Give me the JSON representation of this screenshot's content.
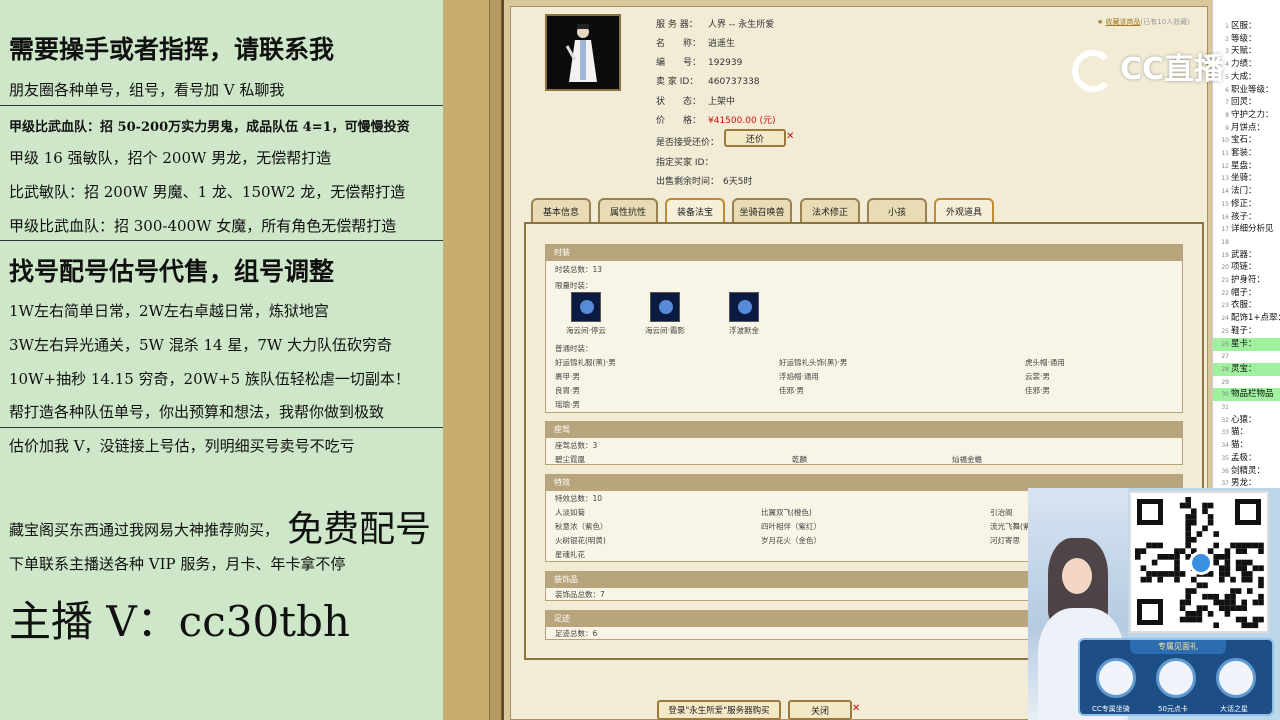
{
  "ad": {
    "line1": "需要操手或者指挥，请联系我",
    "line2": "朋友圈各种单号，组号，看号加 V 私聊我",
    "line3": "甲级比武血队：招 50-200万实力男鬼，成品队伍 4=1，可慢慢投资",
    "line4": "甲级 16 强敏队，招个 200W 男龙，无偿帮打造",
    "line5": "比武敏队：招 200W 男魔、1 龙、150W2 龙，无偿帮打造",
    "line6": "甲级比武血队：招 300-400W 女魔，所有角色无偿帮打造",
    "line7": "找号配号估号代售，组号调整",
    "line8": "1W左右简单日常，2W左右卓越日常，炼狱地宫",
    "line9": "3W左右异光通关，5W 混杀 14 星，7W 大力队伍砍穷奇",
    "line10": "10W+抽秒 14.15 穷奇，20W+5 族队伍轻松虐一切副本！",
    "line11": "帮打造各种队伍单号，你出预算和想法，我帮你做到极致",
    "line12": "估价加我 V，没链接上号估，列明细买号卖号不吃亏",
    "line13a": "藏宝阁买东西通过我网易大神推荐购买，",
    "line13b": "免费配号",
    "line14": "下单联系主播送各种 VIP 服务，月卡、年卡拿不停",
    "line15": "主播 V：cc30tbh"
  },
  "item": {
    "server_k": "服 务 器：",
    "server_v": "人界 -- 永生所爱",
    "name_k": "名　　称：",
    "name_v": "逍遥生",
    "num_k": "编　　号：",
    "num_v": "192939",
    "seller_k": "卖 家 ID：",
    "seller_v": "460737338",
    "status_k": "状　　态：",
    "status_v": "上架中",
    "price_k": "价　　格：",
    "price_v": "¥41500.00 (元)",
    "bargain_k": "是否接受还价：",
    "bargain_btn": "还价",
    "buyer_k": "指定买家 ID：",
    "remain_k": "出售剩余时间：",
    "remain_v": "6天5时",
    "fav": "收藏该商品",
    "fav_count": "(已有10人收藏)"
  },
  "tabs": [
    "基本信息",
    "属性抗性",
    "装备法宝",
    "坐骑召唤兽",
    "法术修正",
    "小孩",
    "外观道具"
  ],
  "sections": {
    "fashion": {
      "title": "时装",
      "total": "时装总数：13",
      "limited": "限量时装：",
      "icons": [
        "海云间·停云",
        "海云间·霜影",
        "浮波默金"
      ],
      "normal": "普通时装：",
      "items": [
        "好运锦礼服(黑)·男",
        "好运锦礼头饰(黑)·男",
        "虎头帽·通用",
        "裹甲·男",
        "浮焰帽·通用",
        "云裳·男",
        "良胄·男",
        "佳邪·男",
        "佳邪·男",
        "瑶瑜·男"
      ]
    },
    "ride": {
      "title": "座驾",
      "total": "座驾总数：3",
      "items": [
        "碧尘霓凰",
        "乾麟",
        "灿福金蟾"
      ]
    },
    "effect": {
      "title": "特效",
      "total": "特效总数：10",
      "items": [
        "人淡如菊",
        "比翼双飞(橙色)",
        "引治阁",
        "秋意浓（紫色）",
        "四叶相伴（紫红）",
        "流光飞舞(紫)",
        "火树银花(明黄)",
        "岁月花火（金色）",
        "河灯寄思",
        "星魂礼花"
      ]
    },
    "deco": {
      "title": "装饰品",
      "total": "装饰品总数：7"
    },
    "foot": {
      "title": "足迹",
      "total": "足迹总数：6"
    }
  },
  "footer": {
    "login_btn": "登录\"永生所爱\"服务器购买",
    "close_btn": "关闭"
  },
  "right_list": [
    {
      "n": "1",
      "t": "区服："
    },
    {
      "n": "2",
      "t": "等级："
    },
    {
      "n": "3",
      "t": "天赋："
    },
    {
      "n": "4",
      "t": "力绩："
    },
    {
      "n": "5",
      "t": "大成："
    },
    {
      "n": "6",
      "t": "职业等级："
    },
    {
      "n": "7",
      "t": "回灵："
    },
    {
      "n": "8",
      "t": "守护之力："
    },
    {
      "n": "9",
      "t": "月饼点："
    },
    {
      "n": "10",
      "t": "宝石："
    },
    {
      "n": "11",
      "t": "套装："
    },
    {
      "n": "12",
      "t": "星盘："
    },
    {
      "n": "13",
      "t": "坐骑："
    },
    {
      "n": "14",
      "t": "法门："
    },
    {
      "n": "15",
      "t": "修正："
    },
    {
      "n": "16",
      "t": "孩子："
    },
    {
      "n": "17",
      "t": "详细分析见"
    },
    {
      "n": "18",
      "t": ""
    },
    {
      "n": "19",
      "t": "武器："
    },
    {
      "n": "20",
      "t": "项链："
    },
    {
      "n": "21",
      "t": "护身符："
    },
    {
      "n": "22",
      "t": "帽子："
    },
    {
      "n": "23",
      "t": "衣服："
    },
    {
      "n": "24",
      "t": "配饰1+点翠："
    },
    {
      "n": "25",
      "t": "鞋子："
    },
    {
      "n": "26",
      "t": "星卡："
    },
    {
      "n": "27",
      "t": ""
    },
    {
      "n": "28",
      "t": "灵宝："
    },
    {
      "n": "29",
      "t": ""
    },
    {
      "n": "30",
      "t": "物品栏物品"
    },
    {
      "n": "31",
      "t": ""
    },
    {
      "n": "32",
      "t": "心猿："
    },
    {
      "n": "33",
      "t": "猫："
    },
    {
      "n": "34",
      "t": "猫："
    },
    {
      "n": "35",
      "t": "孟极："
    },
    {
      "n": "36",
      "t": "剑精灵："
    },
    {
      "n": "37",
      "t": "男龙："
    }
  ],
  "right_list_highlight": [
    "26",
    "28",
    "30"
  ],
  "overlay": {
    "cc_logo": "CC直播",
    "gift_title": "专属见面礼",
    "gift1": "CC专属坐骑",
    "gift2": "50元点卡",
    "gift3": "大话之星"
  }
}
